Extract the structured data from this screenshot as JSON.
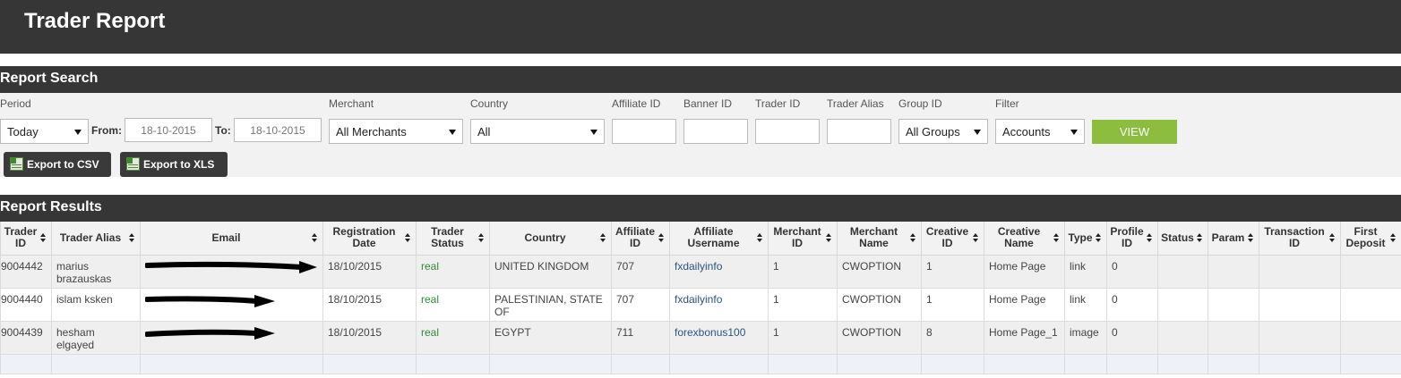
{
  "header": {
    "title": "Trader Report"
  },
  "search": {
    "section_title": "Report Search",
    "period": {
      "label": "Period",
      "value": "Today"
    },
    "from": {
      "label": "From:",
      "value": "18-10-2015"
    },
    "to": {
      "label": "To:",
      "value": "18-10-2015"
    },
    "merchant": {
      "label": "Merchant",
      "value": "All Merchants"
    },
    "country": {
      "label": "Country",
      "value": "All"
    },
    "affiliate_id": {
      "label": "Affiliate ID",
      "value": ""
    },
    "banner_id": {
      "label": "Banner ID",
      "value": ""
    },
    "trader_id": {
      "label": "Trader ID",
      "value": ""
    },
    "trader_alias": {
      "label": "Trader Alias",
      "value": ""
    },
    "group_id": {
      "label": "Group ID",
      "value": "All Groups"
    },
    "filter": {
      "label": "Filter",
      "value": "Accounts"
    },
    "view_label": "VIEW",
    "export_csv_label": "Export to CSV",
    "export_xls_label": "Export to XLS"
  },
  "results": {
    "section_title": "Report Results",
    "columns": [
      "Trader ID",
      "Trader Alias",
      "Email",
      "Registration Date",
      "Trader Status",
      "Country",
      "Affiliate ID",
      "Affiliate Username",
      "Merchant ID",
      "Merchant Name",
      "Creative ID",
      "Creative Name",
      "Type",
      "Profile ID",
      "Status",
      "Param",
      "Transaction ID",
      "First Deposit"
    ],
    "rows": [
      {
        "trader_id": "9004442",
        "trader_alias": "marius brazauskas",
        "registration_date": "18/10/2015",
        "trader_status": "real",
        "country": "UNITED KINGDOM",
        "affiliate_id": "707",
        "affiliate_username": "fxdailyinfo",
        "merchant_id": "1",
        "merchant_name": "CWOPTION",
        "creative_id": "1",
        "creative_name": "Home Page",
        "type": "link",
        "profile_id": "0"
      },
      {
        "trader_id": "9004440",
        "trader_alias": "islam ksken",
        "registration_date": "18/10/2015",
        "trader_status": "real",
        "country": "PALESTINIAN, STATE OF",
        "affiliate_id": "707",
        "affiliate_username": "fxdailyinfo",
        "merchant_id": "1",
        "merchant_name": "CWOPTION",
        "creative_id": "1",
        "creative_name": "Home Page",
        "type": "link",
        "profile_id": "0"
      },
      {
        "trader_id": "9004439",
        "trader_alias": "hesham elgayed",
        "registration_date": "18/10/2015",
        "trader_status": "real",
        "country": "EGYPT",
        "affiliate_id": "711",
        "affiliate_username": "forexbonus100",
        "merchant_id": "1",
        "merchant_name": "CWOPTION",
        "creative_id": "8",
        "creative_name": "Home Page_1",
        "type": "image",
        "profile_id": "0"
      }
    ]
  },
  "colors": {
    "dark_bar": "#363636",
    "panel_bg": "#f2f2f2",
    "view_button": "#8cbd3f",
    "status_green": "#2f8a3a",
    "link_blue": "#2b5480"
  }
}
